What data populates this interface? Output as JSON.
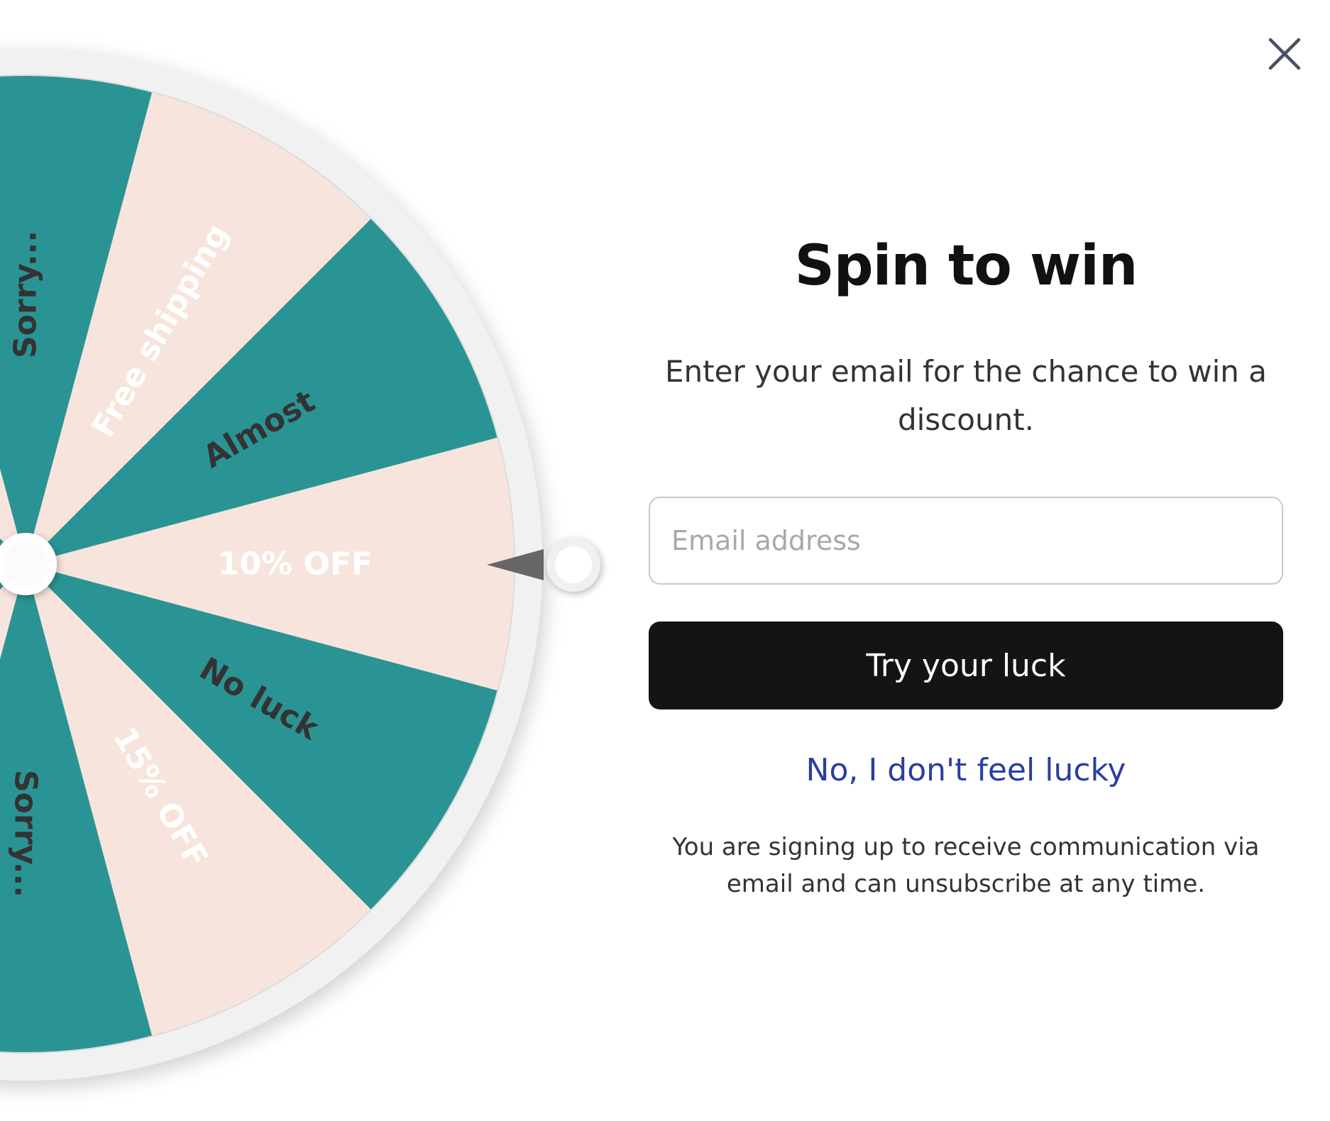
{
  "popup": {
    "title": "Spin to win",
    "subtitle": "Enter your email for the chance to win a discount.",
    "email_placeholder": "Email address",
    "submit_label": "Try your luck",
    "decline_label": "No, I don't feel lucky",
    "disclaimer": "You are signing up to receive communication via email and can unsubscribe at any time."
  },
  "close": {
    "icon": "close-icon"
  },
  "wheel": {
    "colors": {
      "teal": "#2a9494",
      "peach": "#f7e4dc",
      "rim": "#dcdcdc",
      "hub": "#ffffff",
      "pointer": "#666666"
    },
    "segments": [
      {
        "label": "10% OFF",
        "color": "teal",
        "text_color": "#ffffff"
      },
      {
        "label": "Almost",
        "color": "peach",
        "text_color": "#333333"
      },
      {
        "label": "Free shipping",
        "color": "teal",
        "text_color": "#ffffff"
      },
      {
        "label": "Sorry...",
        "color": "peach",
        "text_color": "#333333"
      },
      {
        "label": "",
        "color": "teal",
        "text_color": "#ffffff"
      },
      {
        "label": "",
        "color": "peach",
        "text_color": "#333333"
      },
      {
        "label": "",
        "color": "teal",
        "text_color": "#ffffff"
      },
      {
        "label": "",
        "color": "peach",
        "text_color": "#333333"
      },
      {
        "label": "",
        "color": "teal",
        "text_color": "#ffffff"
      },
      {
        "label": "Sorry...",
        "color": "peach",
        "text_color": "#333333"
      },
      {
        "label": "15% OFF",
        "color": "teal",
        "text_color": "#ffffff"
      },
      {
        "label": "No luck",
        "color": "peach",
        "text_color": "#333333"
      }
    ]
  }
}
